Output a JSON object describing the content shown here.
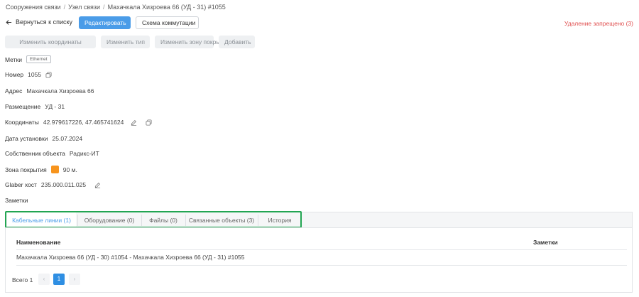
{
  "breadcrumb": {
    "items": [
      "Сооружения связи",
      "Узел связи",
      "Махачкала Хизроева 66 (УД - 31) #1055"
    ],
    "separator": "/"
  },
  "toolbar": {
    "back_label": "Вернуться к списку",
    "edit_label": "Редактировать",
    "schema_label": "Схема коммутации",
    "delete_forbidden": "Удаление запрещено (3)"
  },
  "actions": {
    "change_coords": "Изменить координаты",
    "change_type": "Изменить тип",
    "change_zone": "Изменить зону покрытия",
    "add": "Добавить"
  },
  "fields": {
    "tags_label": "Метки",
    "tag_value": "Ethernet",
    "number_label": "Номер",
    "number_value": "1055",
    "address_label": "Адрес",
    "address_value": "Махачкала Хизроева 66",
    "placement_label": "Размещение",
    "placement_value": "УД - 31",
    "coords_label": "Координаты",
    "coords_value": "42.979617226, 47.465741624",
    "install_date_label": "Дата установки",
    "install_date_value": "25.07.2024",
    "owner_label": "Собственник объекта",
    "owner_value": "Радикс-ИТ",
    "zone_label": "Зона покрытия",
    "zone_value": "90 м.",
    "zone_color": "#f7941d",
    "glaber_label": "Glaber хост",
    "glaber_value": "235.000.011.025",
    "notes_label": "Заметки"
  },
  "tabs": [
    {
      "label": "Кабельные линии (1)",
      "active": true
    },
    {
      "label": "Оборудование (0)",
      "active": false
    },
    {
      "label": "Файлы (0)",
      "active": false
    },
    {
      "label": "Связанные объекты (3)",
      "active": false
    },
    {
      "label": "История",
      "active": false
    }
  ],
  "table": {
    "columns": [
      "Наименование",
      "Заметки"
    ],
    "rows": [
      {
        "name": "Махачкала Хизроева 66 (УД - 30) #1054 - Махачкала Хизроева 66 (УД - 31) #1055",
        "notes": ""
      }
    ]
  },
  "pagination": {
    "total_label": "Всего 1",
    "prev": "‹",
    "next": "›",
    "current_page": "1"
  },
  "colors": {
    "primary": "#4a9ce8",
    "danger": "#e05050",
    "highlight": "#22a552"
  }
}
